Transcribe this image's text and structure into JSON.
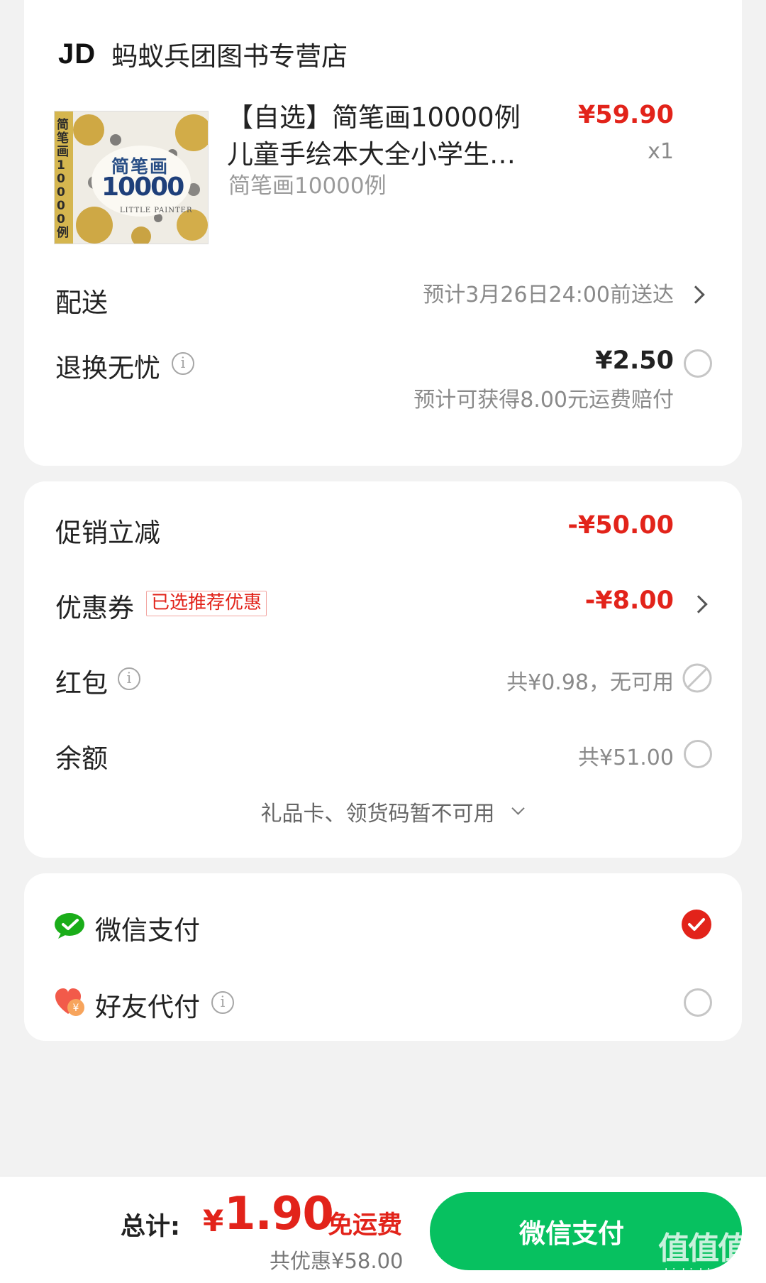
{
  "store": {
    "logo_text": "JD",
    "name": "蚂蚁兵团图书专营店"
  },
  "product": {
    "cover_title": "简笔画",
    "cover_number": "10000",
    "cover_side_text": "简笔画10000例",
    "cover_subtitle": "LITTLE PAINTER",
    "title_line1": "【自选】简笔画10000例",
    "title_line2": "儿童手绘本大全小学生…",
    "spec": "简笔画10000例",
    "price": "¥59.90",
    "qty": "x1"
  },
  "delivery": {
    "label": "配送",
    "value": "预计3月26日24:00前送达"
  },
  "return_insurance": {
    "label": "退换无忧",
    "price": "¥2.50",
    "note": "预计可获得8.00元运费赔付"
  },
  "discounts": {
    "promo_label": "促销立减",
    "promo_value": "-¥50.00",
    "coupon_label": "优惠券",
    "coupon_tag": "已选推荐优惠",
    "coupon_value": "-¥8.00",
    "redpacket_label": "红包",
    "redpacket_value": "共¥0.98，无可用",
    "balance_label": "余额",
    "balance_value": "共¥51.00",
    "giftcard_text": "礼品卡、领货码暂不可用"
  },
  "payment": {
    "wechat_label": "微信支付",
    "friend_label": "好友代付",
    "selected": "微信支付"
  },
  "footer": {
    "total_label": "总计:",
    "total_currency": "¥",
    "total_value": "1.90",
    "shipping_free": "免运费",
    "saved": "共优惠¥58.00",
    "pay_button": "微信支付"
  },
  "watermark": {
    "text": "值值值",
    "domain": "zhizhizhi.com"
  },
  "colors": {
    "accent_red": "#e2231a",
    "pay_green": "#07c160",
    "wechat_green": "#1aad19",
    "background": "#f2f2f2"
  }
}
